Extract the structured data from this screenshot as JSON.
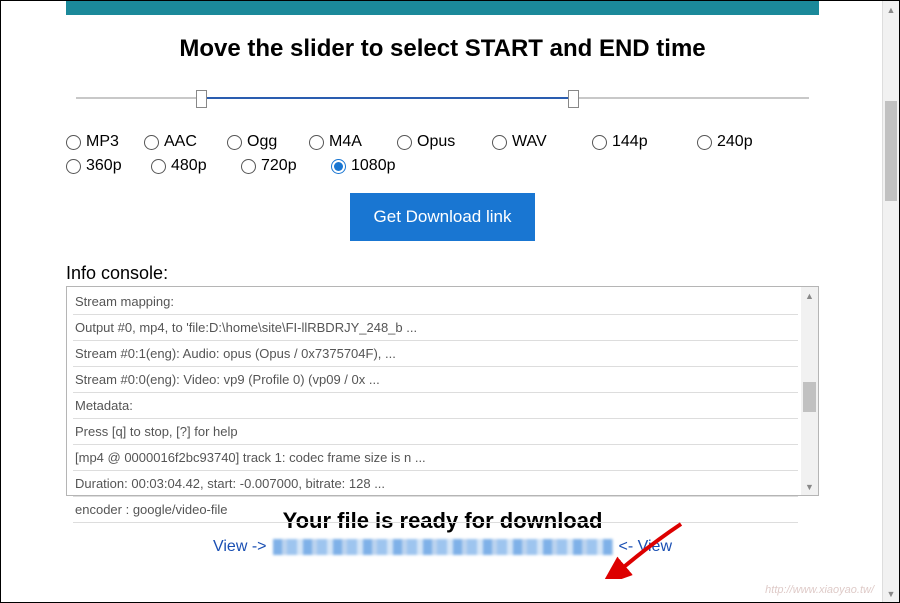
{
  "heading": "Move the slider to select START and END time",
  "formats": {
    "row1": [
      {
        "key": "mp3",
        "label": "MP3",
        "selected": false
      },
      {
        "key": "aac",
        "label": "AAC",
        "selected": false
      },
      {
        "key": "ogg",
        "label": "Ogg",
        "selected": false
      },
      {
        "key": "m4a",
        "label": "M4A",
        "selected": false
      },
      {
        "key": "opus",
        "label": "Opus",
        "selected": false
      },
      {
        "key": "wav",
        "label": "WAV",
        "selected": false
      },
      {
        "key": "p144",
        "label": "144p",
        "selected": false
      },
      {
        "key": "p240",
        "label": "240p",
        "selected": false
      }
    ],
    "row2": [
      {
        "key": "p360",
        "label": "360p",
        "selected": false
      },
      {
        "key": "p480",
        "label": "480p",
        "selected": false
      },
      {
        "key": "p720",
        "label": "720p",
        "selected": false
      },
      {
        "key": "p1080",
        "label": "1080p",
        "selected": true
      }
    ]
  },
  "download_button": "Get Download link",
  "console_label": "Info console:",
  "console_lines": [
    "Stream mapping:",
    "Output #0, mp4, to 'file:D:\\home\\site\\FI-llRBDRJY_248_b ...",
    "Stream #0:1(eng): Audio: opus (Opus / 0x7375704F), ...",
    "Stream #0:0(eng): Video: vp9 (Profile 0) (vp09 / 0x ...",
    "Metadata:",
    "Press [q] to stop, [?] for help",
    "[mp4 @ 0000016f2bc93740] track 1: codec frame size is n ...",
    "Duration: 00:03:04.42, start: -0.007000, bitrate: 128 ...",
    "encoder : google/video-file"
  ],
  "ready_message": "Your file is ready for download",
  "view_left": "View ->",
  "view_right": "<- View",
  "watermark": "http://www.xiaoyao.tw/"
}
